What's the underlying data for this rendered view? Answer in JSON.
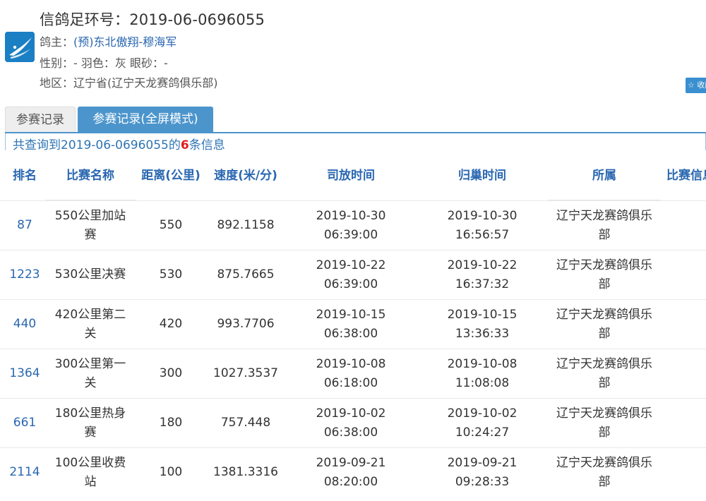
{
  "header": {
    "ring_title": "信鸽足环号：2019-06-0696055",
    "owner_label": "鸽主：",
    "owner_name": "(预)东北傲翔-穆海军",
    "attrs": "性别：- 羽色：灰 眼砂：-",
    "region": "地区：辽宁省(辽宁天龙赛鸽俱乐部)",
    "favorite_label": "☆ 收藏",
    "logo_icon": "club-logo-icon"
  },
  "tabs": [
    {
      "label": "参赛记录",
      "active": false
    },
    {
      "label": "参赛记录(全屏模式)",
      "active": true
    }
  ],
  "summary": {
    "prefix": "共查询到2019-06-0696055的",
    "count": "6",
    "suffix": "条信息"
  },
  "table": {
    "columns": [
      "排名",
      "比赛名称",
      "距离(公里)",
      "速度(米/分)",
      "司放时间",
      "归巢时间",
      "所属",
      "比赛信息"
    ],
    "rows": [
      {
        "rank": "87",
        "race": "550公里加站赛",
        "distance": "550",
        "speed": "892.1158",
        "release": "2019-10-30 06:39:00",
        "arrival": "2019-10-30 16:56:57",
        "club": "辽宁天龙赛鸽俱乐部",
        "info": ""
      },
      {
        "rank": "1223",
        "race": "530公里决赛",
        "distance": "530",
        "speed": "875.7665",
        "release": "2019-10-22 06:39:00",
        "arrival": "2019-10-22 16:37:32",
        "club": "辽宁天龙赛鸽俱乐部",
        "info": ""
      },
      {
        "rank": "440",
        "race": "420公里第二关",
        "distance": "420",
        "speed": "993.7706",
        "release": "2019-10-15 06:38:00",
        "arrival": "2019-10-15 13:36:33",
        "club": "辽宁天龙赛鸽俱乐部",
        "info": ""
      },
      {
        "rank": "1364",
        "race": "300公里第一关",
        "distance": "300",
        "speed": "1027.3537",
        "release": "2019-10-08 06:18:00",
        "arrival": "2019-10-08 11:08:08",
        "club": "辽宁天龙赛鸽俱乐部",
        "info": ""
      },
      {
        "rank": "661",
        "race": "180公里热身赛",
        "distance": "180",
        "speed": "757.448",
        "release": "2019-10-02 06:38:00",
        "arrival": "2019-10-02 10:24:27",
        "club": "辽宁天龙赛鸽俱乐部",
        "info": ""
      },
      {
        "rank": "2114",
        "race": "100公里收费站",
        "distance": "100",
        "speed": "1381.3316",
        "release": "2019-09-21 08:20:00",
        "arrival": "2019-09-21 09:28:33",
        "club": "辽宁天龙赛鸽俱乐部",
        "info": ""
      }
    ]
  },
  "colors": {
    "accent": "#4c95cc",
    "link": "#2a67b1",
    "count_highlight": "#e01c1c"
  }
}
